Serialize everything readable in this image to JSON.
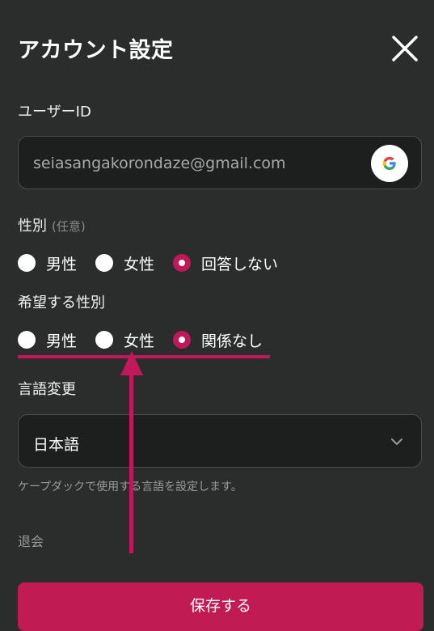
{
  "dialog": {
    "title": "アカウント設定"
  },
  "user_id": {
    "label": "ユーザーID",
    "value": "seiasangakorondaze@gmail.com",
    "provider_icon": "google-icon"
  },
  "gender": {
    "label": "性別",
    "optional": "(任意)",
    "options": [
      {
        "label": "男性",
        "selected": false
      },
      {
        "label": "女性",
        "selected": false
      },
      {
        "label": "回答しない",
        "selected": true
      }
    ]
  },
  "preferred_gender": {
    "label": "希望する性別",
    "options": [
      {
        "label": "男性",
        "selected": false
      },
      {
        "label": "女性",
        "selected": false
      },
      {
        "label": "関係なし",
        "selected": true
      }
    ]
  },
  "language": {
    "label": "言語変更",
    "value": "日本語",
    "help": "ケープダックで使用する言語を設定します。"
  },
  "withdraw_label": "退会",
  "save_label": "保存する",
  "colors": {
    "accent": "#c0185a",
    "background": "#2b2c2c",
    "field_background": "#1d1f1f"
  }
}
